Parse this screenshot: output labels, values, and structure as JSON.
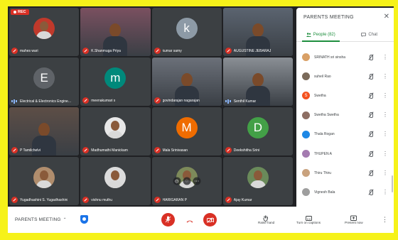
{
  "recording_label": "REC",
  "tiles": [
    {
      "name": "mahes wari",
      "kind": "photo",
      "muted": true,
      "color": "#c0392b"
    },
    {
      "name": "K.Shanmuga Priya",
      "kind": "video",
      "muted": true,
      "color": "#7a5060"
    },
    {
      "name": "kumar samy",
      "kind": "initial",
      "initial": "k",
      "muted": true,
      "color": "#8d9aa6"
    },
    {
      "name": "AUGUSTINE JEBARAJ",
      "kind": "video",
      "muted": true,
      "color": "#5b6470"
    },
    {
      "name": "Electrical & Electronics Engine...",
      "kind": "initial",
      "initial": "E",
      "muted": false,
      "speaking": true,
      "color": "#5f6368"
    },
    {
      "name": "meenakumari s",
      "kind": "initial",
      "initial": "m",
      "muted": true,
      "color": "#00897b"
    },
    {
      "name": "govindarajan nagarajan",
      "kind": "video",
      "muted": true,
      "color": "#6b7079"
    },
    {
      "name": "Senthil Kumar",
      "kind": "video",
      "muted": false,
      "speaking": true,
      "color": "#8a8f95"
    },
    {
      "name": "P Tamilchelvi",
      "kind": "video",
      "muted": true,
      "color": "#5d4e46"
    },
    {
      "name": "Madhumathi Manickam",
      "kind": "photo",
      "muted": true,
      "color": "#e8e8e8"
    },
    {
      "name": "Mala Srinivasan",
      "kind": "initial",
      "initial": "M",
      "muted": true,
      "color": "#ef6c00"
    },
    {
      "name": "Deekshitha Srini",
      "kind": "initial",
      "initial": "D",
      "muted": true,
      "color": "#43a047"
    },
    {
      "name": "Yugadhashini S. Yugadhashini",
      "kind": "photo",
      "muted": true,
      "color": "#b08d6d"
    },
    {
      "name": "vishnu muthu",
      "kind": "photo",
      "muted": true,
      "color": "#dcdcdc"
    },
    {
      "name": "HARIGARAN P",
      "kind": "photo",
      "muted": true,
      "color": "#7d8a5a",
      "hover": true
    },
    {
      "name": "Ajay Kumar",
      "kind": "photo",
      "muted": true,
      "color": "#6a8a5a"
    }
  ],
  "panel": {
    "title": "PARENTS MEETING",
    "close_icon": "close-icon",
    "tab_people": "People (82)",
    "tab_chat": "Chat",
    "people": [
      {
        "name": "SRINATH sri sinsha",
        "avatar_color": "#d9a066"
      },
      {
        "name": "suheil Rao",
        "avatar_color": "#7a6a5a"
      },
      {
        "name": "Swetha",
        "avatar_color": "#f4511e",
        "initial": "S"
      },
      {
        "name": "Swetha Swetha",
        "avatar_color": "#8d6e63"
      },
      {
        "name": "Thala Rogan",
        "avatar_color": "#1e88e5"
      },
      {
        "name": "THUPEN A",
        "avatar_color": "#a47bb0"
      },
      {
        "name": "Thiru Thiru",
        "avatar_color": "#c9a27e"
      },
      {
        "name": "Vignesh Bala",
        "avatar_color": "#9e9e9e"
      }
    ]
  },
  "bar": {
    "meeting_name": "PARENTS MEETING",
    "raise_hand": "Raise hand",
    "captions": "Turn on captions",
    "present": "Present now"
  }
}
